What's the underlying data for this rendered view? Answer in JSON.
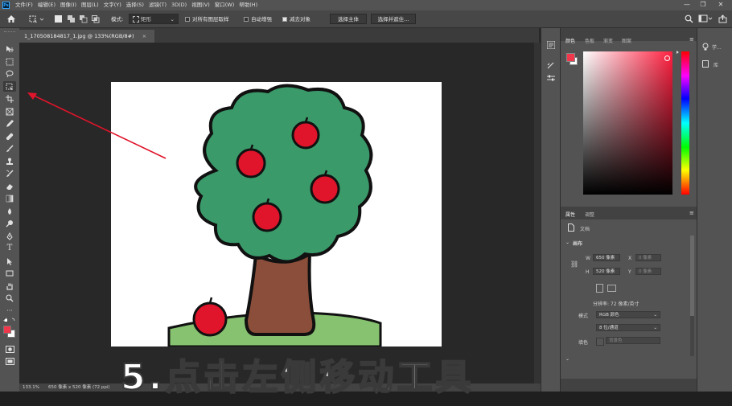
{
  "app": {
    "logo": "Ps"
  },
  "menubar": {
    "items": [
      "文件(F)",
      "编辑(E)",
      "图像(I)",
      "图层(L)",
      "文字(Y)",
      "选择(S)",
      "滤镜(T)",
      "3D(D)",
      "视图(V)",
      "窗口(W)",
      "帮助(H)"
    ]
  },
  "window_controls": {
    "minimize": "—",
    "restore": "❐",
    "close": "✕"
  },
  "options_bar": {
    "mode_label": "模式:",
    "mode_value": "矩形",
    "sample_all_layers": "对所有图层取样",
    "auto_enhance": "自动增强",
    "subtract_object": "减去对象",
    "select_subject": "选择主体",
    "select_and_mask": "选择并遮住..."
  },
  "document": {
    "tab_title": "1_170508184817_1.jpg @ 133%(RGB/8#)",
    "close": "×"
  },
  "status": {
    "zoom": "133.1%",
    "info": "650 像素 x 520 像素 (72 ppi)"
  },
  "color_panel": {
    "tabs": [
      "颜色",
      "色板",
      "渐变",
      "图案"
    ],
    "foreground": "#f0374b",
    "background": "#ffffff"
  },
  "properties_panel": {
    "tabs": [
      "属性",
      "调整"
    ],
    "doc_label": "文档",
    "section": "画布",
    "w_label": "W",
    "w_value": "650 像素",
    "h_label": "H",
    "h_value": "520 像素",
    "x_label": "X",
    "x_value": "0 像素",
    "y_label": "Y",
    "y_value": "0 像素",
    "resolution": "分辨率: 72 像素/英寸",
    "mode_label": "模式",
    "mode_value": "RGB 颜色",
    "depth_value": "8 位/通道",
    "fill_label": "填色",
    "fill_value": "背景色"
  },
  "right_panels": {
    "learn": "学...",
    "library": "库"
  },
  "caption": "5.点击左侧移动工具",
  "colors": {
    "accent_red": "#e0142a",
    "tree_green": "#3a9a6a",
    "trunk": "#8b4e3a"
  }
}
